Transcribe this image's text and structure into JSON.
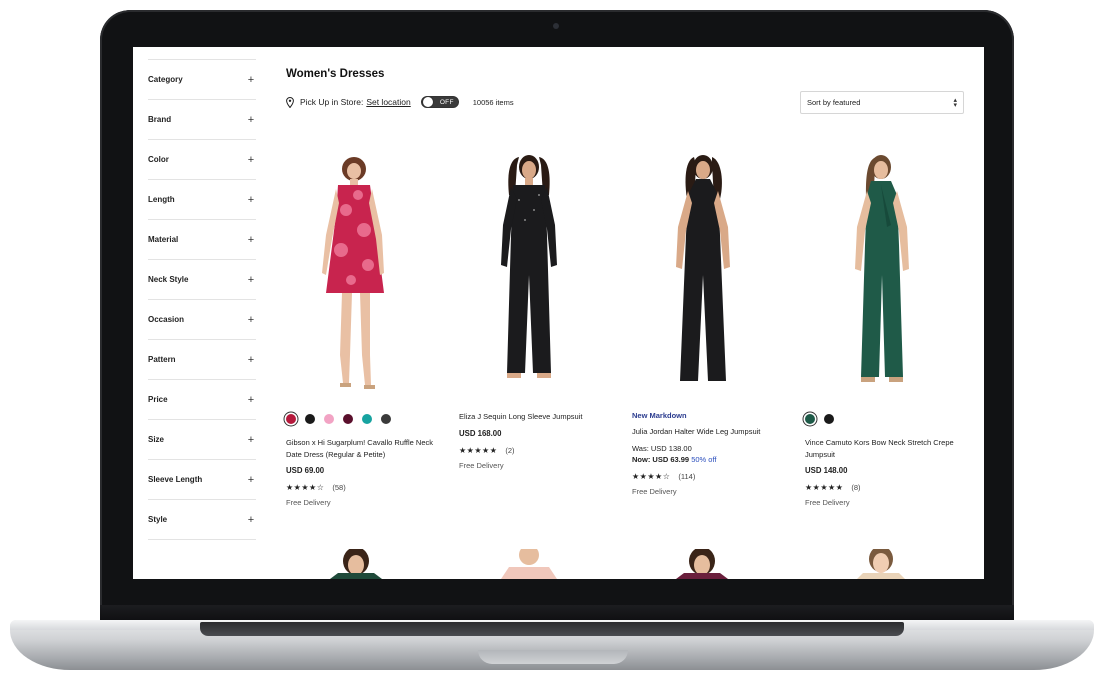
{
  "page": {
    "title": "Women's Dresses",
    "pickup_label": "Pick Up in Store:",
    "set_location": "Set location",
    "toggle_state": "OFF",
    "item_count": "10056 items",
    "sort": {
      "selected": "Sort by featured"
    }
  },
  "sidebar": {
    "filters": [
      {
        "label": "Category"
      },
      {
        "label": "Brand"
      },
      {
        "label": "Color"
      },
      {
        "label": "Length"
      },
      {
        "label": "Material"
      },
      {
        "label": "Neck Style"
      },
      {
        "label": "Occasion"
      },
      {
        "label": "Pattern"
      },
      {
        "label": "Price"
      },
      {
        "label": "Size"
      },
      {
        "label": "Sleeve Length"
      },
      {
        "label": "Style"
      }
    ]
  },
  "products": [
    {
      "name": "Gibson x Hi Sugarplum! Cavallo Ruffle Neck Date Dress (Regular & Petite)",
      "price": "USD 69.00",
      "stars": "★★★★☆",
      "reviews": "(58)",
      "delivery": "Free Delivery",
      "swatches": [
        "#b5193c",
        "#1a1a1a",
        "#f2a3c4",
        "#5a0f2c",
        "#17a3a0",
        "#3a3a3a"
      ]
    },
    {
      "name": "Eliza J Sequin Long Sleeve Jumpsuit",
      "price": "USD 168.00",
      "stars": "★★★★★",
      "reviews": "(2)",
      "delivery": "Free Delivery"
    },
    {
      "tag": "New Markdown",
      "name": "Julia Jordan Halter Wide Leg Jumpsuit",
      "was": "Was: USD 138.00",
      "now": "Now: USD 63.99",
      "off": "50% off",
      "stars": "★★★★☆",
      "reviews": "(114)",
      "delivery": "Free Delivery"
    },
    {
      "name": "Vince Camuto Kors Bow Neck Stretch Crepe Jumpsuit",
      "price": "USD 148.00",
      "stars": "★★★★★",
      "reviews": "(8)",
      "delivery": "Free Delivery",
      "swatches": [
        "#1e5a48",
        "#1a1a1a"
      ]
    }
  ],
  "colors": {
    "accent_link": "#2b4fbd",
    "markdown_tag": "#2b3c8f",
    "dress_red": "#c8244e",
    "jumpsuit_black": "#1b1b1d",
    "jumpsuit_green": "#1f5a48"
  }
}
